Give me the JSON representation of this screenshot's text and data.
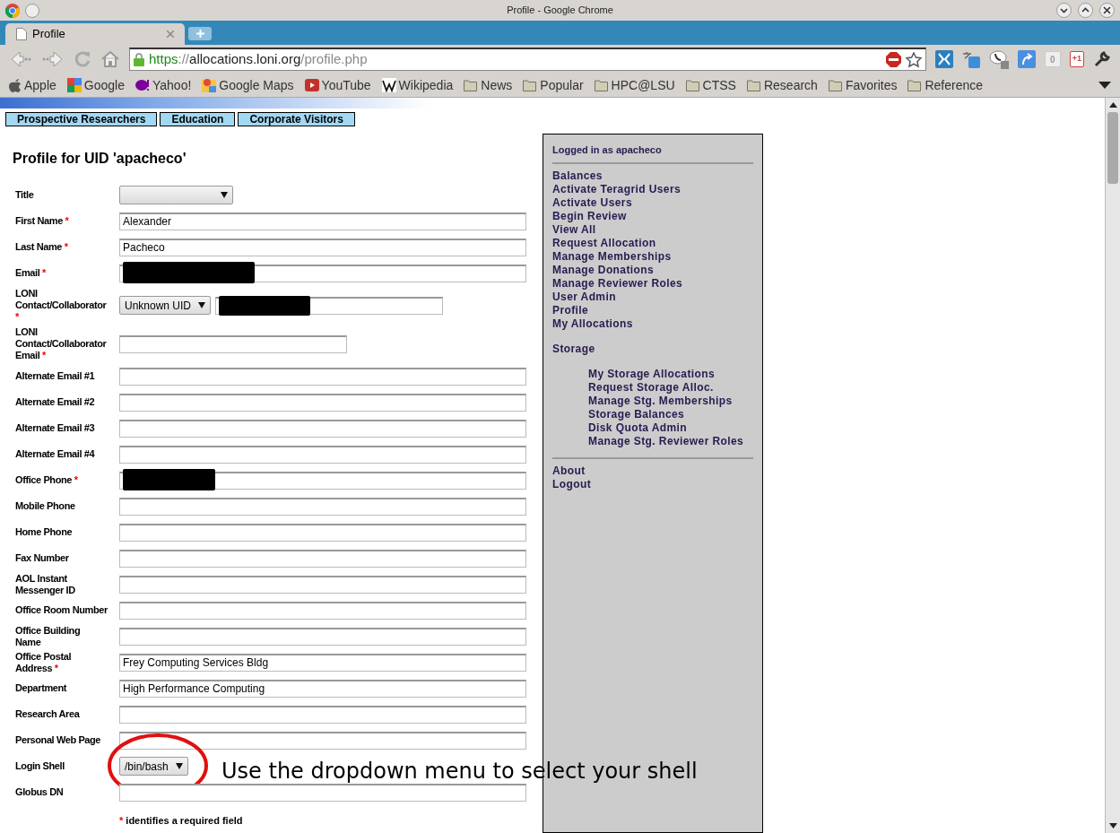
{
  "window": {
    "title": "Profile - Google Chrome"
  },
  "tabs": [
    {
      "label": "Profile",
      "selected": true
    }
  ],
  "address_bar": {
    "scheme": "https",
    "separator": "://",
    "host": "allocations.loni.org",
    "path": "/profile.php"
  },
  "extensions": [
    {
      "kind": "counter",
      "label": "0"
    },
    {
      "kind": "gplus",
      "label": "+1"
    }
  ],
  "bookmarks": [
    {
      "label": "Apple",
      "kind": "apple"
    },
    {
      "label": "Google",
      "kind": "google"
    },
    {
      "label": "Yahoo!",
      "kind": "yahoo"
    },
    {
      "label": "Google Maps",
      "kind": "maps"
    },
    {
      "label": "YouTube",
      "kind": "youtube"
    },
    {
      "label": "Wikipedia",
      "kind": "wiki"
    },
    {
      "label": "News",
      "kind": "folder"
    },
    {
      "label": "Popular",
      "kind": "folder"
    },
    {
      "label": "HPC@LSU",
      "kind": "folder"
    },
    {
      "label": "CTSS",
      "kind": "folder"
    },
    {
      "label": "Research",
      "kind": "folder"
    },
    {
      "label": "Favorites",
      "kind": "folder"
    },
    {
      "label": "Reference",
      "kind": "folder"
    }
  ],
  "top_nav": [
    "Prospective Researchers",
    "Education",
    "Corporate Visitors"
  ],
  "heading": "Profile for UID 'apacheco'",
  "fields": [
    {
      "label": "Title",
      "required": false,
      "kind": "select"
    },
    {
      "label": "First Name",
      "required": true,
      "kind": "text",
      "value": "Alexander"
    },
    {
      "label": "Last Name",
      "required": true,
      "kind": "text",
      "value": "Pacheco"
    },
    {
      "label": "Email",
      "required": true,
      "kind": "redacted"
    },
    {
      "label": "LONI Contact/Collaborator",
      "required": true,
      "kind": "uid",
      "value": "Unknown UID"
    },
    {
      "label": "LONI Contact/Collaborator Email",
      "required": true,
      "kind": "short"
    },
    {
      "label": "Alternate Email #1",
      "required": false,
      "kind": "text"
    },
    {
      "label": "Alternate Email #2",
      "required": false,
      "kind": "text"
    },
    {
      "label": "Alternate Email #3",
      "required": false,
      "kind": "text"
    },
    {
      "label": "Alternate Email #4",
      "required": false,
      "kind": "text"
    },
    {
      "label": "Office Phone",
      "required": true,
      "kind": "redacted"
    },
    {
      "label": "Mobile Phone",
      "required": false,
      "kind": "text"
    },
    {
      "label": "Home Phone",
      "required": false,
      "kind": "text"
    },
    {
      "label": "Fax Number",
      "required": false,
      "kind": "text"
    },
    {
      "label": "AOL Instant Messenger ID",
      "required": false,
      "kind": "text"
    },
    {
      "label": "Office Room Number",
      "required": false,
      "kind": "text"
    },
    {
      "label": "Office Building Name",
      "required": false,
      "kind": "text"
    },
    {
      "label": "Office Postal Address",
      "required": true,
      "kind": "text",
      "value": "Frey Computing Services Bldg"
    },
    {
      "label": "Department",
      "required": false,
      "kind": "text",
      "value": "High Performance Computing"
    },
    {
      "label": "Research Area",
      "required": false,
      "kind": "text"
    },
    {
      "label": "Personal Web Page",
      "required": false,
      "kind": "text"
    },
    {
      "label": "Login Shell",
      "required": false,
      "kind": "select",
      "value": "/bin/bash"
    },
    {
      "label": "Globus DN",
      "required": false,
      "kind": "text"
    }
  ],
  "required_note": {
    "mark": "*",
    "text": "identifies a required field"
  },
  "sidebar": {
    "logged_in": "Logged in as apacheco",
    "items": [
      "Balances",
      "Activate Teragrid Users",
      "Activate Users",
      "Begin Review",
      "View All",
      "Request Allocation",
      "Manage Memberships",
      "Manage Donations",
      "Manage Reviewer Roles",
      "User Admin",
      "Profile",
      "My Allocations"
    ],
    "section": "Storage",
    "sub_items": [
      "My Storage Allocations",
      "Request Storage Alloc.",
      "Manage Stg. Memberships",
      "Storage Balances",
      "Disk Quota Admin",
      "Manage Stg. Reviewer Roles"
    ],
    "footer_items": [
      "About",
      "Logout"
    ]
  },
  "annotation": "Use the dropdown menu to select your shell"
}
